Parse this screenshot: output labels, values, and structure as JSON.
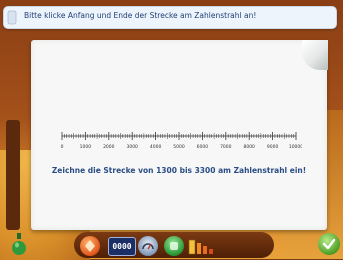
{
  "instruction": {
    "text": "Bitte klicke Anfang und Ende der Strecke am Zahlenstrahl an!"
  },
  "numberline": {
    "labels": [
      "0",
      "1000",
      "2000",
      "3000",
      "4000",
      "5000",
      "6000",
      "7000",
      "8000",
      "9000",
      "10000"
    ]
  },
  "task": {
    "text": "Zeichne die Strecke von 1300 bis 3300 am Zahlenstrahl ein!"
  },
  "toolbar": {
    "display_value": "0000"
  },
  "icons": {
    "potion": "potion-icon",
    "orange_button": "diamond-button-icon",
    "gauge": "gauge-icon",
    "green_button": "green-button-icon",
    "bars": "bar-chart-icon",
    "check": "checkmark-icon"
  },
  "colors": {
    "instruction_text": "#1f3f78",
    "task_text": "#2b4d86",
    "paper": "#f6f7f6"
  }
}
